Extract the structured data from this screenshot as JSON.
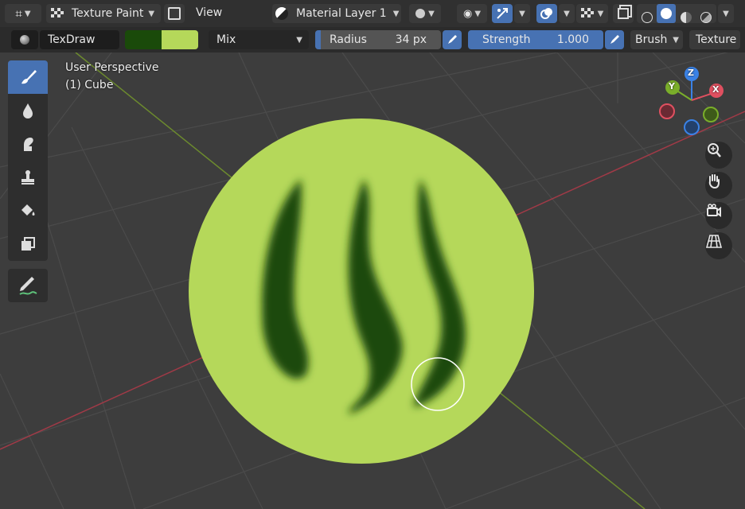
{
  "header": {
    "mode": {
      "label": "Texture Paint"
    },
    "view_menu": {
      "label": "View"
    },
    "layer": {
      "label": "Material Layer 1"
    }
  },
  "tool_settings": {
    "brush_name": "TexDraw",
    "colors": {
      "primary": "#1a4a0a",
      "secondary": "#b5d85a"
    },
    "blend_mode": "Mix",
    "radius": {
      "label": "Radius",
      "value": "34 px"
    },
    "strength": {
      "label": "Strength",
      "value": "1.000"
    },
    "brush_menu": "Brush",
    "texture_menu": "Texture"
  },
  "viewport": {
    "info_line1": "User Perspective",
    "info_line2": "(1) Cube",
    "gizmo": {
      "z_label": "Z",
      "y_label": "Y",
      "x_label": "X"
    }
  },
  "toolbar": {
    "tools": [
      {
        "name": "draw",
        "icon": "brush-icon",
        "active": true
      },
      {
        "name": "soften",
        "icon": "drop-icon",
        "active": false
      },
      {
        "name": "smear",
        "icon": "smear-icon",
        "active": false
      },
      {
        "name": "clone",
        "icon": "stamp-icon",
        "active": false
      },
      {
        "name": "fill",
        "icon": "bucket-icon",
        "active": false
      },
      {
        "name": "mask",
        "icon": "mask-icon",
        "active": false
      },
      {
        "name": "annotate",
        "icon": "annotate-icon",
        "active": false
      }
    ]
  },
  "theme": {
    "accent": "#4772b3",
    "header_bg": "#303030",
    "viewport_bg": "#3d3d3d",
    "sphere_color": "#b5d85a",
    "stroke_color": "#1a4a0a"
  }
}
